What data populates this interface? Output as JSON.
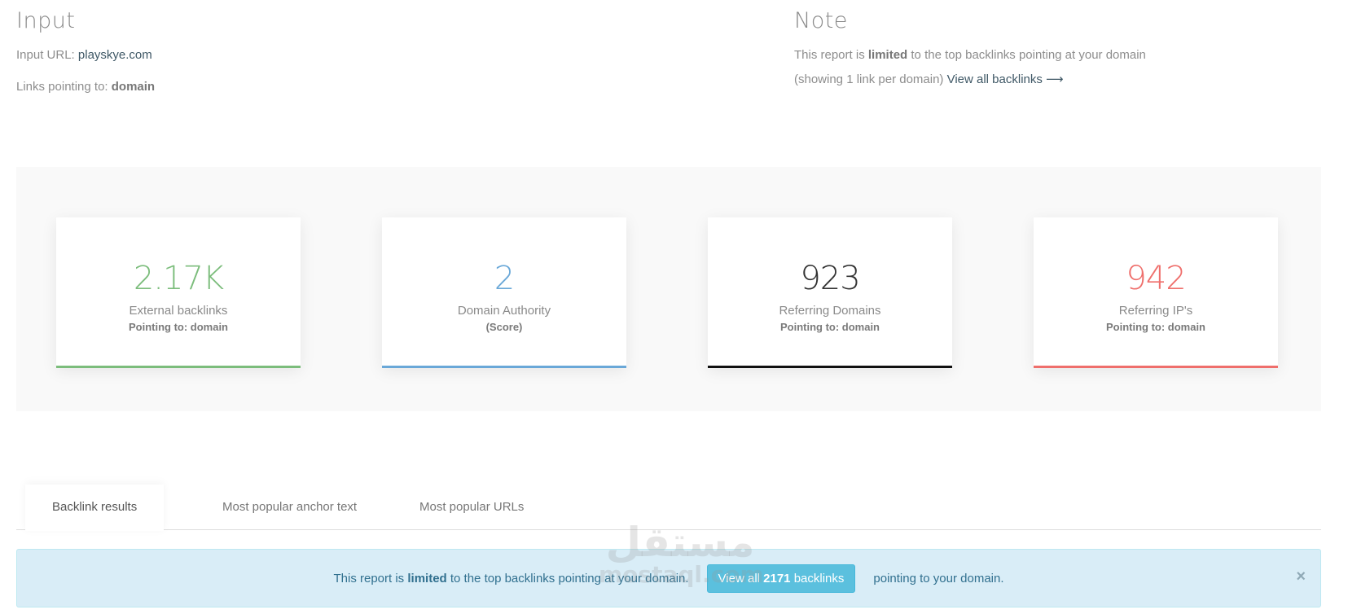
{
  "input": {
    "title": "Input",
    "url_label": "Input URL:",
    "url_value": "playskye.com",
    "links_label": "Links pointing to:",
    "links_value": "domain"
  },
  "note": {
    "title": "Note",
    "line1_pre": "This report is",
    "line1_bold": "limited",
    "line1_post": "to the top backlinks pointing at your domain",
    "line2_pre": "(showing 1 link per domain)",
    "link_text": "View all backlinks ⟶"
  },
  "stats": [
    {
      "value": "2.17K",
      "label": "External backlinks",
      "sub": "Pointing to: domain",
      "color": "#7cbd7c"
    },
    {
      "value": "2",
      "label": "Domain Authority",
      "sub": "(Score)",
      "color": "#6aa8d8"
    },
    {
      "value": "923",
      "label": "Referring Domains",
      "sub": "Pointing to: domain",
      "color": "#333333"
    },
    {
      "value": "942",
      "label": "Referring IP's",
      "sub": "Pointing to: domain",
      "color": "#ef6f6c"
    }
  ],
  "tabs": [
    {
      "label": "Backlink results",
      "active": true
    },
    {
      "label": "Most popular anchor text",
      "active": false
    },
    {
      "label": "Most popular URLs",
      "active": false
    }
  ],
  "alert": {
    "pre": "This report is",
    "bold": "limited",
    "mid": "to the top backlinks pointing at your domain.",
    "btn_pre": "View all",
    "btn_count": "2171",
    "btn_post": "backlinks",
    "post": "pointing to your domain.",
    "close": "×"
  },
  "watermark": {
    "arabic": "مستقل",
    "latin": "mostaql.com"
  }
}
